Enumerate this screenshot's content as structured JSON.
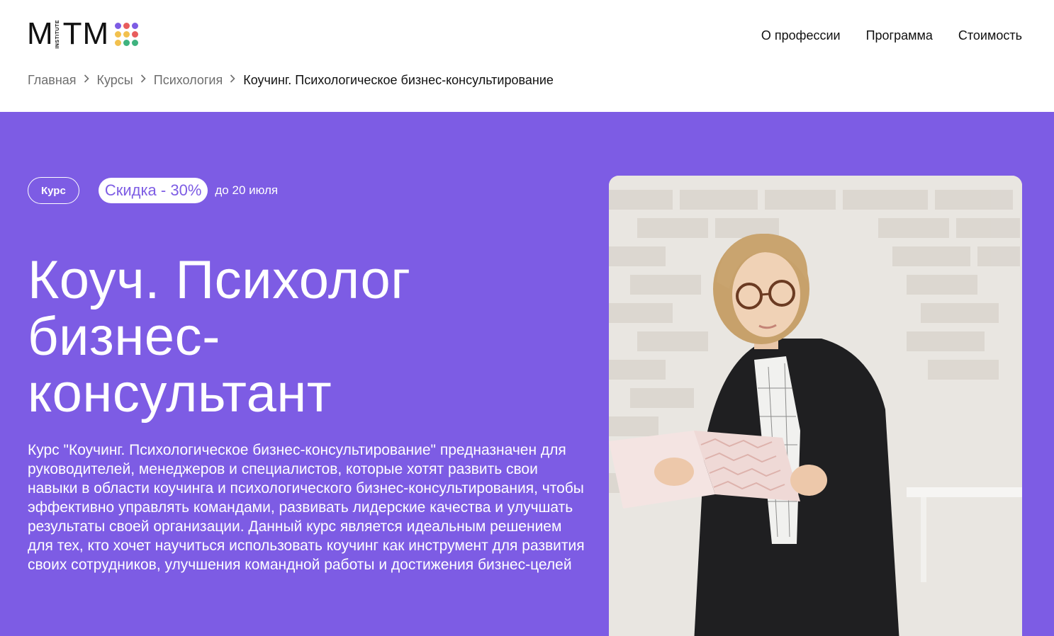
{
  "logo": {
    "left": "M",
    "vertical": "INSTITUTE",
    "right": "TM",
    "dot_colors": [
      "#7d5ce4",
      "#e85d5d",
      "#7d5ce4",
      "#f2c14e",
      "#f2c14e",
      "#e85d5d",
      "#f2c14e",
      "#3fb37f",
      "#3fb37f"
    ]
  },
  "nav": {
    "items": [
      "О профессии",
      "Программа",
      "Стоимость"
    ]
  },
  "breadcrumb": {
    "items": [
      "Главная",
      "Курсы",
      "Психология"
    ],
    "current": "Коучинг. Психологическое бизнес-консультирование"
  },
  "hero": {
    "background": "#7d5ce4",
    "badge_course": "Курс",
    "badge_sale": "Скидка - 30%",
    "sale_until": "до 20 июля",
    "title_lines": [
      "Коуч. Психолог",
      "бизнес-",
      "консультант"
    ],
    "description": "Курс \"Коучинг. Психологическое бизнес-консультирование\" предназначен для руководителей, менеджеров и специалистов, которые хотят развить свои навыки в области коучинга и психологического бизнес-консультирования, чтобы эффективно управлять командами, развивать лидерские качества и улучшать результаты своей организации. Данный курс является идеальным решением для тех, кто хочет научиться использовать коучинг как инструмент для развития своих сотрудников, улучшения командной работы и достижения бизнес-целей"
  }
}
